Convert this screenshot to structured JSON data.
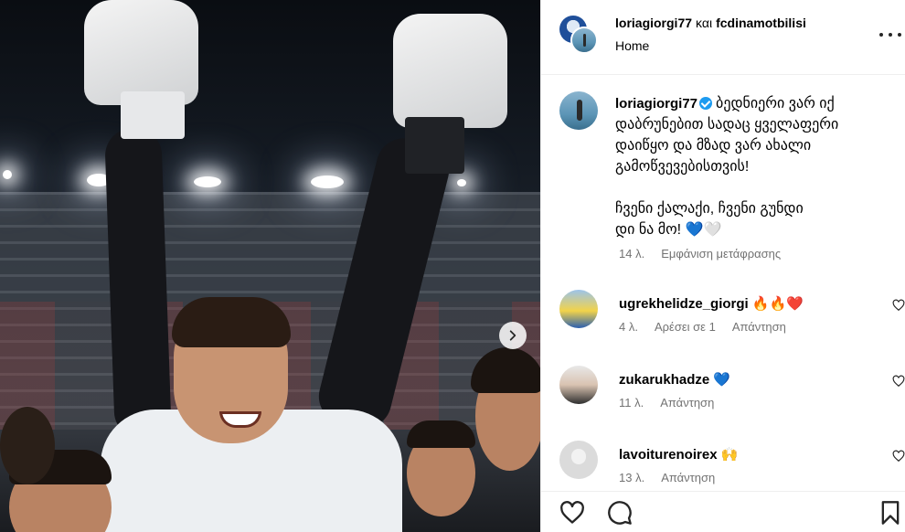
{
  "header": {
    "user1": "loriagiorgi77",
    "conjunction": "και",
    "user2": "fcdinamotbilisi",
    "location": "Home"
  },
  "caption": {
    "user": "loriagiorgi77",
    "text": "ბედნიერი ვარ იქ\nდაბრუნებით სადაც ყველაფერი\nდაიწყო და მზად ვარ ახალი\nგამოწვევებისთვის!",
    "text2": "ჩვენი ქალაქი, ჩვენი გუნდი\nდი ნა მო! 💙🤍",
    "time": "14 λ.",
    "translate": "Εμφάνιση μετάφρασης"
  },
  "comments": [
    {
      "user": "ugrekhelidze_giorgi",
      "text": "🔥🔥❤️",
      "time": "4 λ.",
      "likes": "Αρέσει σε 1",
      "reply": "Απάντηση"
    },
    {
      "user": "zukarukhadze",
      "text": "💙",
      "time": "11 λ.",
      "likes": "",
      "reply": "Απάντηση"
    },
    {
      "user": "lavoiturenoirex",
      "text": "🙌",
      "time": "13 λ.",
      "likes": "",
      "reply": "Απάντηση"
    }
  ],
  "icons": {
    "like": "heart-icon",
    "comment": "comment-icon",
    "save": "bookmark-icon",
    "more": "more-icon",
    "next": "chevron-right-icon"
  },
  "colors": {
    "verified": "#1d9bf0",
    "muted": "#737373",
    "border": "#efefef"
  }
}
